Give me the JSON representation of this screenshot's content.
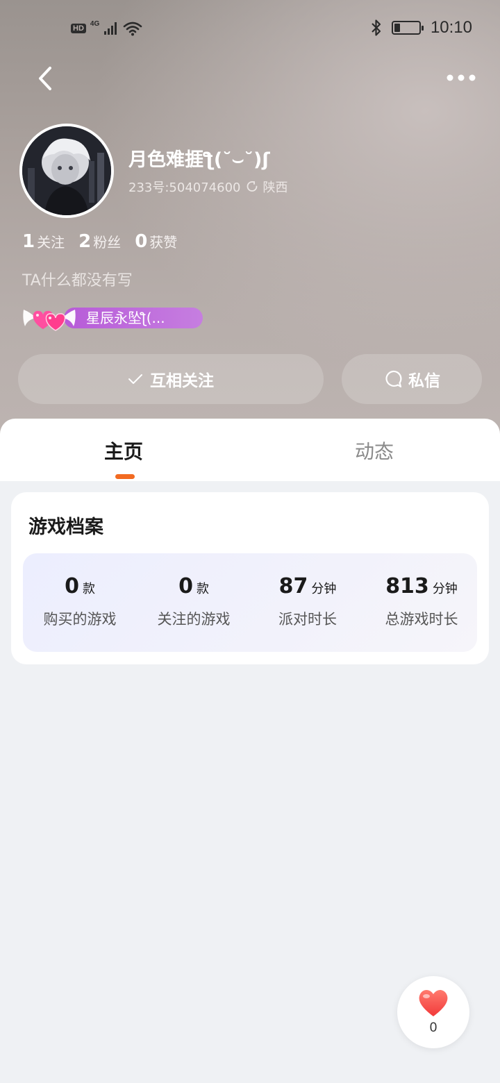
{
  "status_bar": {
    "hd": "HD",
    "network": "4G",
    "time": "10:10",
    "icons": [
      "signal-icon",
      "wifi-icon",
      "bluetooth-icon",
      "battery-icon"
    ]
  },
  "nav": {
    "back_icon": "chevron-left-icon",
    "more_icon": "more-horizontal-icon"
  },
  "profile": {
    "username": "月色难捱ƪ(˘⌣˘)ʃ",
    "id_text": "233号:504074600",
    "location": "陕西",
    "stats": [
      {
        "num": "1",
        "label": "关注"
      },
      {
        "num": "2",
        "label": "粉丝"
      },
      {
        "num": "0",
        "label": "获赞"
      }
    ],
    "bio": "TA什么都没有写",
    "badge_text": "星辰永坠ƪ(..."
  },
  "actions": {
    "follow_label": "互相关注",
    "message_label": "私信"
  },
  "tabs": [
    {
      "label": "主页",
      "active": true
    },
    {
      "label": "动态",
      "active": false
    }
  ],
  "game_profile": {
    "title": "游戏档案",
    "stats": [
      {
        "value": "0",
        "unit": "款",
        "label": "购买的游戏"
      },
      {
        "value": "0",
        "unit": "款",
        "label": "关注的游戏"
      },
      {
        "value": "87",
        "unit": "分钟",
        "label": "派对时长"
      },
      {
        "value": "813",
        "unit": "分钟",
        "label": "总游戏时长"
      }
    ]
  },
  "like": {
    "count": "0"
  },
  "colors": {
    "accent": "#f26a21",
    "badge_purple": "#b75bd8",
    "like_red": "#ff4d4d"
  }
}
